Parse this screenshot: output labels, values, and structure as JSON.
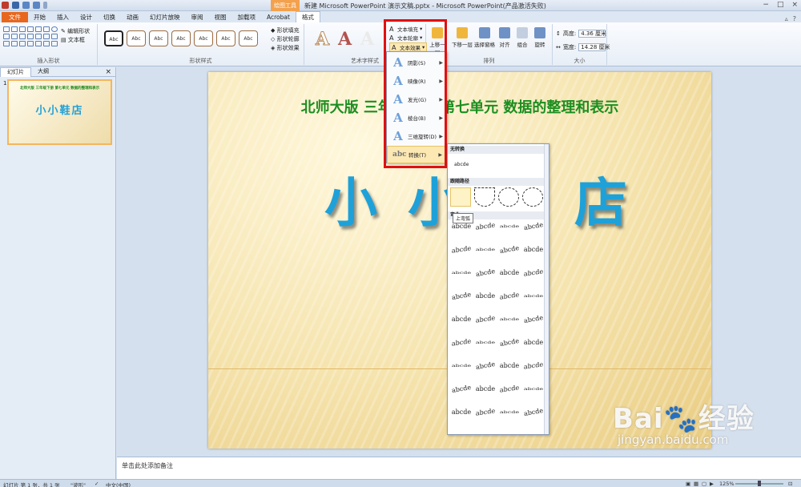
{
  "window": {
    "title": "新建 Microsoft PowerPoint 演示文稿.pptx - Microsoft PowerPoint(产品激活失败)",
    "context_tab_head": "绘图工具",
    "controls": [
      "−",
      "□",
      "×"
    ]
  },
  "tabs": [
    "文件",
    "开始",
    "插入",
    "设计",
    "切换",
    "动画",
    "幻灯片放映",
    "审阅",
    "视图",
    "加载项",
    "Acrobat",
    "格式"
  ],
  "ribbon": {
    "insert_shapes": {
      "label": "插入形状",
      "edit_shape": "编辑形状",
      "text_box": "文本框"
    },
    "shape_styles": {
      "label": "形状样式",
      "sample": "Abc",
      "fill": "形状填充",
      "outline": "形状轮廓",
      "effects": "形状效果"
    },
    "wordart": {
      "label": "艺术字样式",
      "sample": "A",
      "text_fill": "文本填充",
      "text_outline": "文本轮廓",
      "text_effects": "文本效果"
    },
    "arrange": {
      "label": "排列",
      "bring_forward": "上移一层",
      "send_backward": "下移一层",
      "selection_pane": "选择窗格",
      "align": "对齐",
      "group": "组合",
      "rotate": "旋转"
    },
    "size": {
      "label": "大小",
      "height_label": "高度:",
      "height_value": "4.36 厘米",
      "width_label": "宽度:",
      "width_value": "14.28 厘米"
    }
  },
  "left_panel": {
    "tabs": [
      "幻灯片",
      "大纲"
    ],
    "close": "×",
    "slide_number": "1",
    "thumb_title": "北师大版 三年级下册 第七单元 数据的整理和表示",
    "thumb_big": "小小鞋店"
  },
  "slide": {
    "title": "北师大版 三年级下册 第七单元 数据的整理和表示",
    "big_text": "小小鞋店"
  },
  "text_effects_menu": {
    "items": [
      {
        "label": "阴影(S)",
        "icon": "shadow-a-icon"
      },
      {
        "label": "映像(R)",
        "icon": "reflection-a-icon"
      },
      {
        "label": "发光(G)",
        "icon": "glow-a-icon"
      },
      {
        "label": "棱台(B)",
        "icon": "bevel-a-icon"
      },
      {
        "label": "三维旋转(D)",
        "icon": "3d-rotation-a-icon"
      },
      {
        "label": "转换(T)",
        "icon": "transform-abc-icon"
      }
    ],
    "highlighted": "转换(T)"
  },
  "transform_submenu": {
    "no_transform_header": "无转换",
    "no_transform_sample": "abcde",
    "follow_path_header": "跟随路径",
    "warp_header": "弯曲",
    "tooltip": "上弯弧",
    "warp_sample": "abcde"
  },
  "notes": {
    "placeholder": "单击此处添加备注"
  },
  "status_bar": {
    "slide_info": "幻灯片 第 1 张，共 1 张",
    "theme": "\"波形\"",
    "language": "中文(中国)",
    "zoom": "125%"
  },
  "watermark": {
    "logo": "Bai",
    "logo_suffix": "经验",
    "site": "jingyan.baidu.com"
  },
  "colors": {
    "file_tab": "#e7671f",
    "slide_title": "#1c8e20",
    "slide_big": "#1ea1d9",
    "highlight_box": "#e01010",
    "menu_highlight": "#fce8b2"
  }
}
